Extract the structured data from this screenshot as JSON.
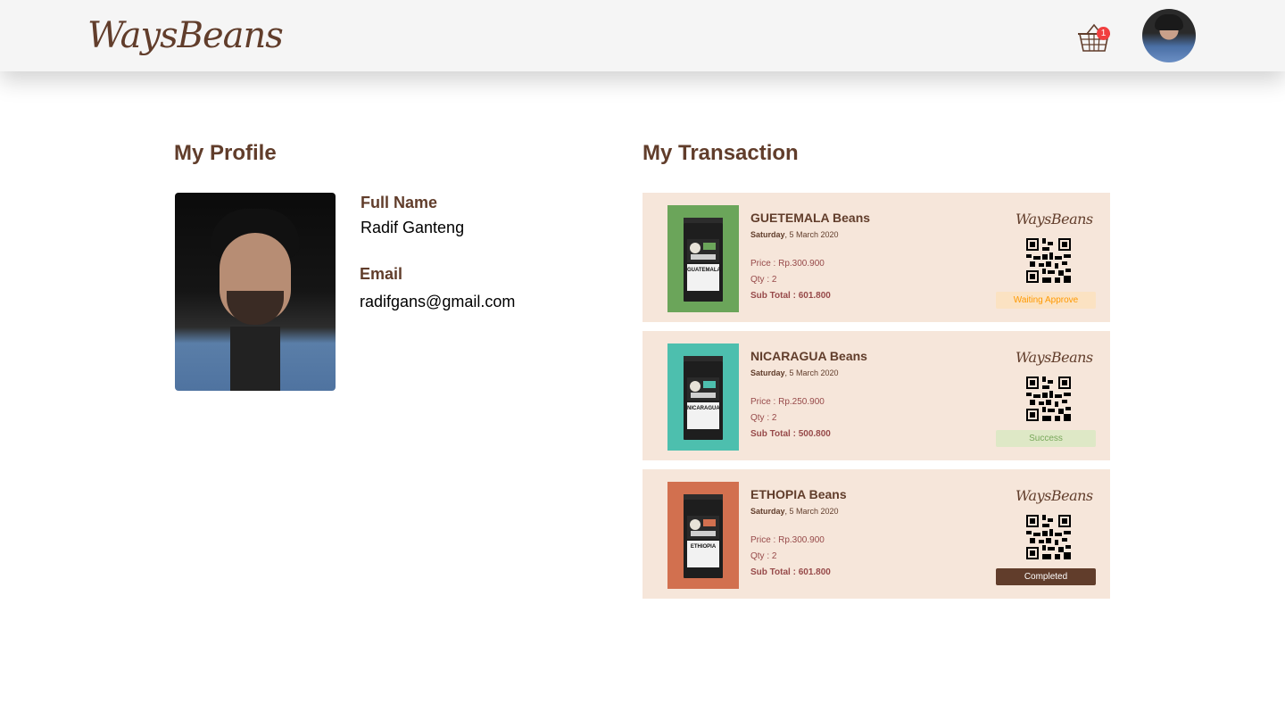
{
  "navbar": {
    "logo_text": "WaysBeans",
    "cart_count": "1"
  },
  "profile": {
    "title": "My Profile",
    "full_name_label": "Full Name",
    "full_name": "Radif Ganteng",
    "email_label": "Email",
    "email": "radifgans@gmail.com"
  },
  "transactions": {
    "title": "My Transaction",
    "items": [
      {
        "name": "GUETEMALA Beans",
        "day": "Saturday",
        "date": ", 5 March 2020",
        "price": "Price : Rp.300.900",
        "qty": "Qty : 2",
        "subtotal": "Sub Total : 601.800",
        "bag_label": "GUATEMALA",
        "bg_color": "#6BA55A",
        "logo": "WaysBeans",
        "status": "Waiting Approve",
        "status_bg": "#FBE2C2",
        "status_color": "#FF9900"
      },
      {
        "name": "NICARAGUA Beans",
        "day": "Saturday",
        "date": ", 5 March 2020",
        "price": "Price : Rp.250.900",
        "qty": "Qty : 2",
        "subtotal": "Sub Total : 500.800",
        "bag_label": "NICARAGUA",
        "bg_color": "#4DBFAE",
        "logo": "WaysBeans",
        "status": "Success",
        "status_bg": "#DEE8C6",
        "status_color": "#78A85A"
      },
      {
        "name": "ETHOPIA Beans",
        "day": "Saturday",
        "date": ", 5 March 2020",
        "price": "Price : Rp.300.900",
        "qty": "Qty : 2",
        "subtotal": "Sub Total : 601.800",
        "bag_label": "ETHIOPIA",
        "bg_color": "#D2704F",
        "logo": "WaysBeans",
        "status": "Completed",
        "status_bg": "#613D2B",
        "status_color": "#FFFFFF"
      }
    ]
  }
}
